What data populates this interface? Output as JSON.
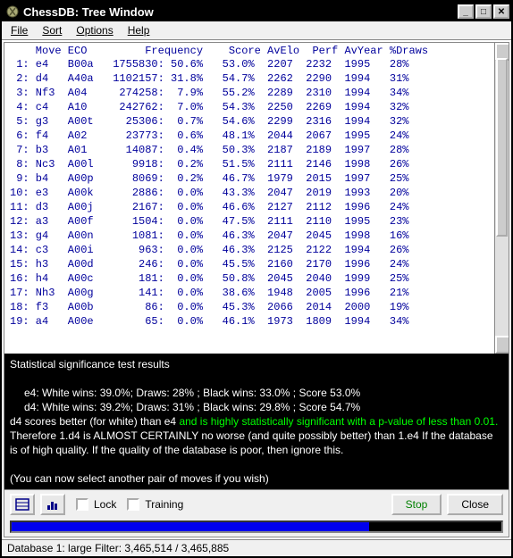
{
  "title": "ChessDB: Tree Window",
  "menu": {
    "file": "File",
    "sort": "Sort",
    "options": "Options",
    "help": "Help"
  },
  "columns": {
    "move": "Move",
    "eco": "ECO",
    "frequency": "Frequency",
    "score": "Score",
    "avelo": "AvElo",
    "perf": "Perf",
    "avyear": "AvYear",
    "draws": "%Draws"
  },
  "rows": [
    {
      "n": "1",
      "move": "e4",
      "eco": "B00a",
      "freq": "1755830",
      "pct": "50.6%",
      "score": "53.0%",
      "avelo": "2207",
      "perf": "2232",
      "avyear": "1995",
      "draws": "28%"
    },
    {
      "n": "2",
      "move": "d4",
      "eco": "A40a",
      "freq": "1102157",
      "pct": "31.8%",
      "score": "54.7%",
      "avelo": "2262",
      "perf": "2290",
      "avyear": "1994",
      "draws": "31%"
    },
    {
      "n": "3",
      "move": "Nf3",
      "eco": "A04",
      "freq": "274258",
      "pct": "7.9%",
      "score": "55.2%",
      "avelo": "2289",
      "perf": "2310",
      "avyear": "1994",
      "draws": "34%"
    },
    {
      "n": "4",
      "move": "c4",
      "eco": "A10",
      "freq": "242762",
      "pct": "7.0%",
      "score": "54.3%",
      "avelo": "2250",
      "perf": "2269",
      "avyear": "1994",
      "draws": "32%"
    },
    {
      "n": "5",
      "move": "g3",
      "eco": "A00t",
      "freq": "25306",
      "pct": "0.7%",
      "score": "54.6%",
      "avelo": "2299",
      "perf": "2316",
      "avyear": "1994",
      "draws": "32%"
    },
    {
      "n": "6",
      "move": "f4",
      "eco": "A02",
      "freq": "23773",
      "pct": "0.6%",
      "score": "48.1%",
      "avelo": "2044",
      "perf": "2067",
      "avyear": "1995",
      "draws": "24%"
    },
    {
      "n": "7",
      "move": "b3",
      "eco": "A01",
      "freq": "14087",
      "pct": "0.4%",
      "score": "50.3%",
      "avelo": "2187",
      "perf": "2189",
      "avyear": "1997",
      "draws": "28%"
    },
    {
      "n": "8",
      "move": "Nc3",
      "eco": "A00l",
      "freq": "9918",
      "pct": "0.2%",
      "score": "51.5%",
      "avelo": "2111",
      "perf": "2146",
      "avyear": "1998",
      "draws": "26%"
    },
    {
      "n": "9",
      "move": "b4",
      "eco": "A00p",
      "freq": "8069",
      "pct": "0.2%",
      "score": "46.7%",
      "avelo": "1979",
      "perf": "2015",
      "avyear": "1997",
      "draws": "25%"
    },
    {
      "n": "10",
      "move": "e3",
      "eco": "A00k",
      "freq": "2886",
      "pct": "0.0%",
      "score": "43.3%",
      "avelo": "2047",
      "perf": "2019",
      "avyear": "1993",
      "draws": "20%"
    },
    {
      "n": "11",
      "move": "d3",
      "eco": "A00j",
      "freq": "2167",
      "pct": "0.0%",
      "score": "46.6%",
      "avelo": "2127",
      "perf": "2112",
      "avyear": "1996",
      "draws": "24%"
    },
    {
      "n": "12",
      "move": "a3",
      "eco": "A00f",
      "freq": "1504",
      "pct": "0.0%",
      "score": "47.5%",
      "avelo": "2111",
      "perf": "2110",
      "avyear": "1995",
      "draws": "23%"
    },
    {
      "n": "13",
      "move": "g4",
      "eco": "A00n",
      "freq": "1081",
      "pct": "0.0%",
      "score": "46.3%",
      "avelo": "2047",
      "perf": "2045",
      "avyear": "1998",
      "draws": "16%"
    },
    {
      "n": "14",
      "move": "c3",
      "eco": "A00i",
      "freq": "963",
      "pct": "0.0%",
      "score": "46.3%",
      "avelo": "2125",
      "perf": "2122",
      "avyear": "1994",
      "draws": "26%"
    },
    {
      "n": "15",
      "move": "h3",
      "eco": "A00d",
      "freq": "246",
      "pct": "0.0%",
      "score": "45.5%",
      "avelo": "2160",
      "perf": "2170",
      "avyear": "1996",
      "draws": "24%"
    },
    {
      "n": "16",
      "move": "h4",
      "eco": "A00c",
      "freq": "181",
      "pct": "0.0%",
      "score": "50.8%",
      "avelo": "2045",
      "perf": "2040",
      "avyear": "1999",
      "draws": "25%"
    },
    {
      "n": "17",
      "move": "Nh3",
      "eco": "A00g",
      "freq": "141",
      "pct": "0.0%",
      "score": "38.6%",
      "avelo": "1948",
      "perf": "2005",
      "avyear": "1996",
      "draws": "21%"
    },
    {
      "n": "18",
      "move": "f3",
      "eco": "A00b",
      "freq": "86",
      "pct": "0.0%",
      "score": "45.3%",
      "avelo": "2066",
      "perf": "2014",
      "avyear": "2000",
      "draws": "19%"
    },
    {
      "n": "19",
      "move": "a4",
      "eco": "A00e",
      "freq": "65",
      "pct": "0.0%",
      "score": "46.1%",
      "avelo": "1973",
      "perf": "1809",
      "avyear": "1994",
      "draws": "34%"
    }
  ],
  "stats": {
    "heading": "Statistical significance test results",
    "line1": "e4: White wins: 39.0%; Draws: 28% ; Black wins: 33.0% ; Score 53.0%",
    "line2": "d4: White wins: 39.2%; Draws: 31% ; Black wins: 29.8% ; Score 54.7%",
    "line3a": "d4 scores better (for white) than e4 ",
    "line3b": "and is highly statistically significant with a p-value of less than 0.01.",
    "line4": "Therefore 1.d4 is ALMOST CERTAINLY no worse (and quite possibly better) than 1.e4 If the database is of high quality. If the quality of the database is poor, then ignore this.",
    "line5": "(You can now select another pair of moves if you wish)"
  },
  "footer": {
    "lock": "Lock",
    "training": "Training",
    "stop": "Stop",
    "close": "Close"
  },
  "status": "Database 1: large   Filter: 3,465,514 / 3,465,885",
  "progress_pct": 73
}
